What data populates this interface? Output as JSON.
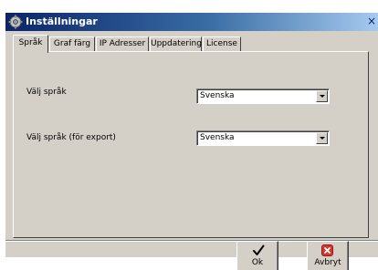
{
  "window": {
    "title": "Inställningar",
    "close_glyph": "×",
    "icons": {
      "app": "settings-app-icon",
      "close": "close-icon"
    }
  },
  "tabs": [
    {
      "label": "Språk",
      "active": true
    },
    {
      "label": "Graf färg",
      "active": false
    },
    {
      "label": "IP Adresser",
      "active": false
    },
    {
      "label": "Uppdatering",
      "active": false
    },
    {
      "label": "License",
      "active": false
    }
  ],
  "language": {
    "label": "Välj språk",
    "value": "Svenska"
  },
  "export_language": {
    "label": "Välj språk (för export)",
    "value": "Svenska"
  },
  "buttons": {
    "ok": {
      "label": "Ok",
      "icon": "checkmark-icon"
    },
    "cancel": {
      "label": "Avbryt",
      "icon": "cancel-x-icon",
      "icon_color": "#d9342b"
    }
  },
  "colors": {
    "titlebar_start": "#0a246a",
    "titlebar_end": "#a6caf0",
    "face": "#d4d0c8"
  }
}
